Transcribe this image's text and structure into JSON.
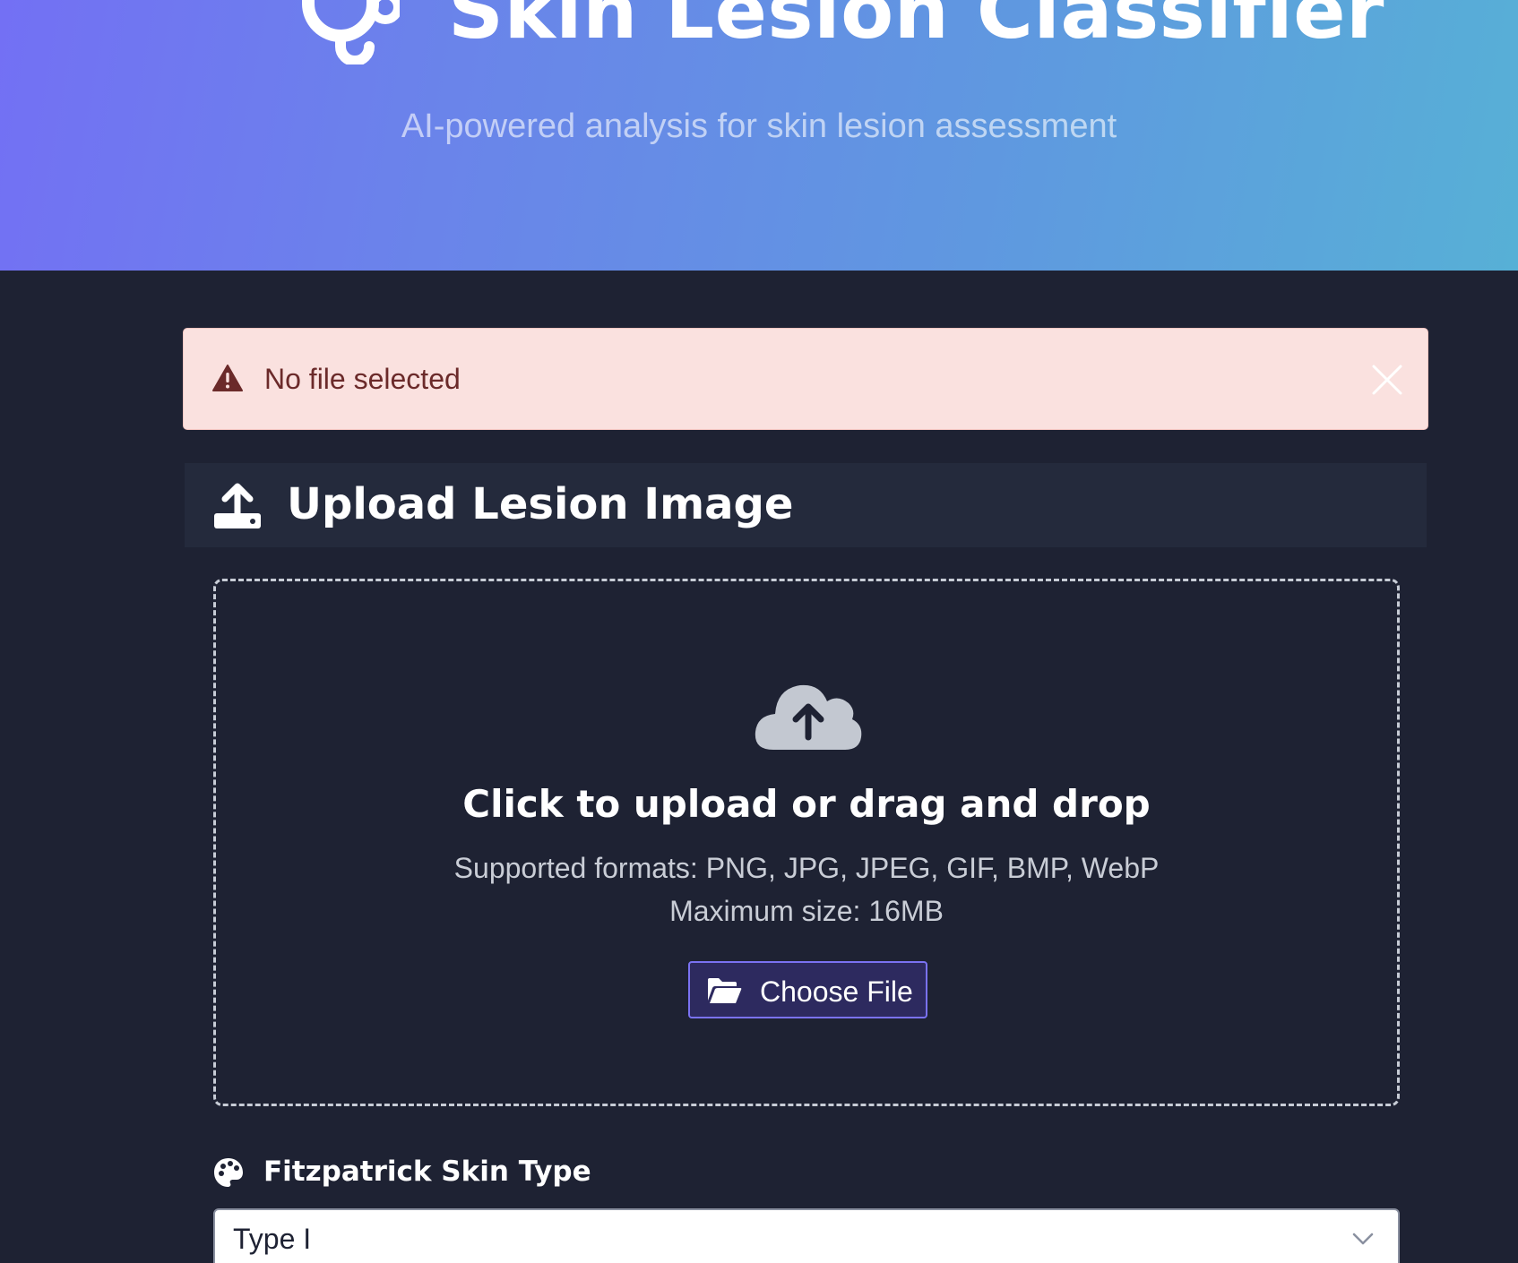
{
  "header": {
    "title": "Skin Lesion Classifier",
    "subtitle": "AI-powered analysis for skin lesion assessment",
    "icon": "stethoscope-icon"
  },
  "alert": {
    "message": "No file selected",
    "icon": "warning-icon",
    "close_icon": "close-icon",
    "background": "#fae1df",
    "text_color": "#6b2a2a"
  },
  "upload_card": {
    "title": "Upload Lesion Image",
    "icon": "upload-icon",
    "dropzone": {
      "icon": "cloud-upload-icon",
      "title": "Click to upload or drag and drop",
      "formats": "Supported formats: PNG, JPG, JPEG, GIF, BMP, WebP",
      "max_size": "Maximum size: 16MB",
      "button_label": "Choose File",
      "button_icon": "folder-open-icon"
    }
  },
  "skin_type": {
    "label": "Fitzpatrick Skin Type",
    "icon": "palette-icon",
    "selected": "Type I"
  },
  "colors": {
    "background": "#1e2233",
    "gradient_start": "#7370f4",
    "gradient_end": "#57b0d6",
    "accent": "#7a72f2"
  }
}
